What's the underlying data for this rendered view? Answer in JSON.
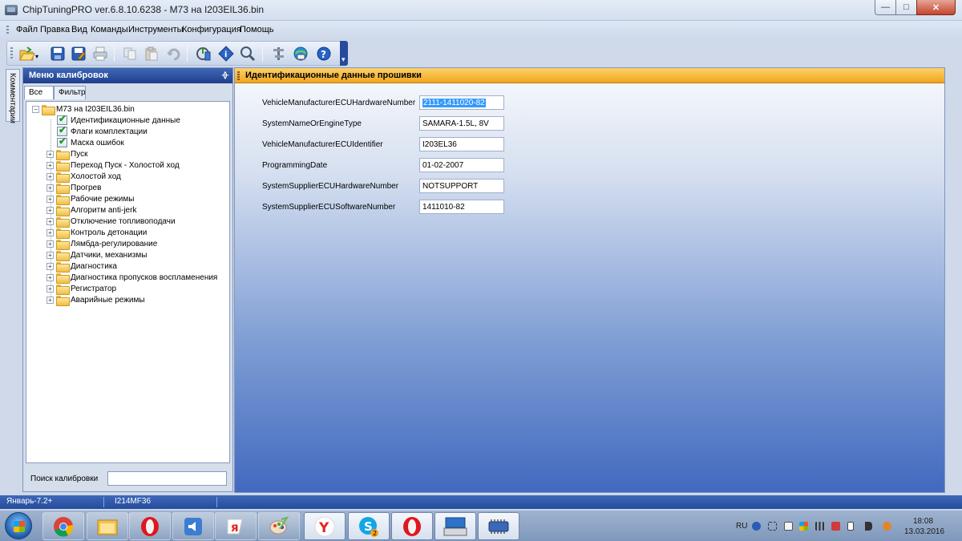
{
  "window": {
    "title": "ChipTuningPRO ver.6.8.10.6238 - M73 на I203EIL36.bin",
    "minimize_glyph": "—",
    "maximize_glyph": "□",
    "close_glyph": "✕"
  },
  "menu": {
    "items": [
      "Файл",
      "Правка",
      "Вид",
      "Команды",
      "Инструменты",
      "Конфигурация",
      "Помощь"
    ]
  },
  "toolbar": {
    "buttons": [
      "open-icon",
      "save-icon",
      "save-as-icon",
      "print-icon",
      "copy-icon",
      "paste-icon",
      "undo-icon",
      "read-ecu-icon",
      "info-icon",
      "search-ecu-icon",
      "tools-icon",
      "update-icon",
      "help-icon"
    ]
  },
  "side_tab": {
    "label": "Комментарии"
  },
  "left_panel": {
    "title": "Меню калибровок",
    "pin_glyph": "ᚖ",
    "tabs": [
      "Все",
      "Фильтр"
    ],
    "tree": {
      "root": "M73 на I203EIL36.bin",
      "checked_items": [
        "Идентификационные данные",
        "Флаги комплектации",
        "Маска ошибок"
      ],
      "folders": [
        "Пуск",
        "Переход Пуск - Холостой ход",
        "Холостой ход",
        "Прогрев",
        "Рабочие режимы",
        "Алгоритм anti-jerk",
        "Отключение топливоподачи",
        "Контроль детонации",
        "Лямбда-регулирование",
        "Датчики, механизмы",
        "Диагностика",
        "Диагностика пропусков воспламенения",
        "Регистратор",
        "Аварийные режимы"
      ]
    },
    "search": {
      "label": "Поиск калибровки",
      "value": ""
    }
  },
  "main_panel": {
    "title": "Идентификационные данные прошивки",
    "fields": [
      {
        "label": "VehicleManufacturerECUHardwareNumber",
        "value": "2111-1411020-82",
        "selected": true
      },
      {
        "label": "SystemNameOrEngineType",
        "value": "SAMARA-1.5L, 8V"
      },
      {
        "label": "VehicleManufacturerECUIdentifier",
        "value": "I203EL36"
      },
      {
        "label": "ProgrammingDate",
        "value": "01-02-2007"
      },
      {
        "label": "SystemSupplierECUHardwareNumber",
        "value": "NOTSUPPORT"
      },
      {
        "label": "SystemSupplierECUSoftwareNumber",
        "value": "1411010-82"
      }
    ]
  },
  "status_bar": {
    "left": "Январь-7.2+",
    "middle": "I214MF36"
  },
  "taskbar": {
    "apps": [
      "chrome-icon",
      "file-explorer-icon",
      "opera-icon",
      "volume-app-icon",
      "yandex-icon",
      "paint-icon",
      "yandex-browser-icon",
      "skype-icon",
      "opera-icon",
      "keyboard-app-icon",
      "chiptuning-icon"
    ],
    "skype_badge": "2",
    "tray": {
      "lang": "RU",
      "time": "18:08",
      "date": "13.03.2016"
    }
  },
  "colors": {
    "panel_header": "#2a4f9f",
    "main_header": "#f5b12e",
    "status_bar": "#2f58a9",
    "selection": "#3399ff"
  }
}
